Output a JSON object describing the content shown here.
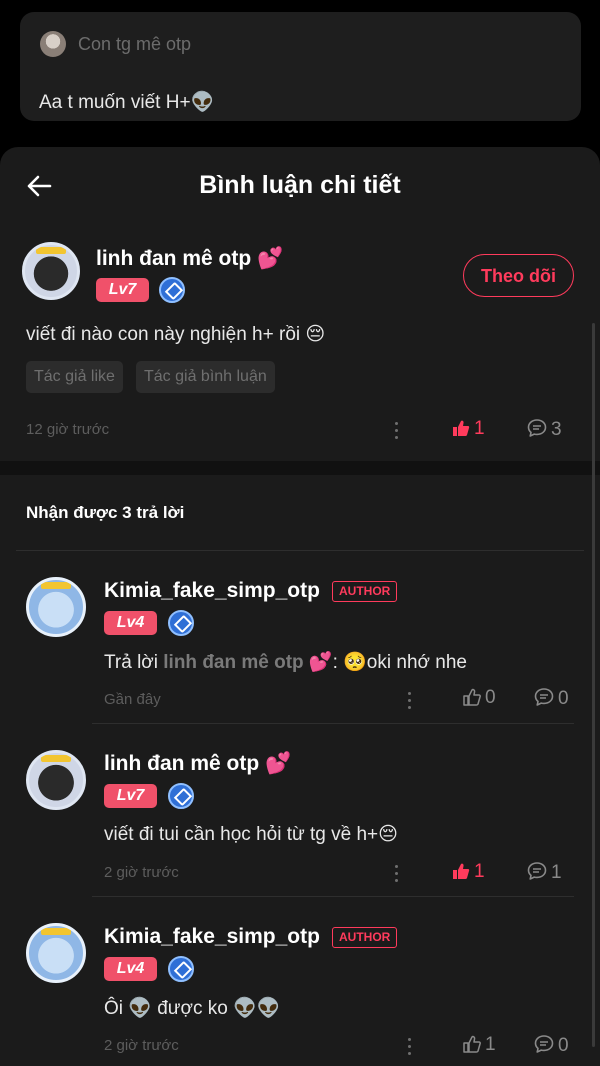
{
  "top_card": {
    "author": "Con tg mê otp",
    "text": "Aa t muốn viết H+👽"
  },
  "header": {
    "title": "Bình luận chi tiết"
  },
  "main_comment": {
    "name": "linh đan mê otp",
    "heart": "💕",
    "level": "Lv7",
    "follow_label": "Theo dõi",
    "text": "viết đi nào con này nghiện h+ rồi 😔",
    "tags": [
      "Tác giả like",
      "Tác giả bình luận"
    ],
    "time": "12 giờ trước",
    "likes": "1",
    "replies": "3"
  },
  "replies_section": {
    "title": "Nhận được 3 trả lời"
  },
  "replies": [
    {
      "name": "Kimia_fake_simp_otp",
      "author_tag": "AUTHOR",
      "level": "Lv4",
      "prefix": "Trả lời ",
      "mention": "linh đan mê otp 💕",
      "text": ": 🥺oki  nhớ nhe",
      "time": "Gần đây",
      "likes": "0",
      "replies": "0"
    },
    {
      "name": "linh đan mê otp",
      "heart": "💕",
      "level": "Lv7",
      "text": "viết đi tui cần học hỏi từ tg về h+😔",
      "time": "2 giờ trước",
      "likes": "1",
      "replies": "1"
    },
    {
      "name": "Kimia_fake_simp_otp",
      "author_tag": "AUTHOR",
      "level": "Lv4",
      "text": "Ôi 👽 được ko 👽👽",
      "time": "2 giờ trước",
      "likes": "1",
      "replies": "0"
    }
  ],
  "colors": {
    "accent": "#ff3b5c",
    "level_badge": "#f0516a",
    "background": "#1b1b1b"
  },
  "icons": [
    "back-arrow-icon",
    "diamond-pen-icon",
    "more-dots-icon",
    "thumb-up-icon",
    "comment-bubble-icon"
  ]
}
